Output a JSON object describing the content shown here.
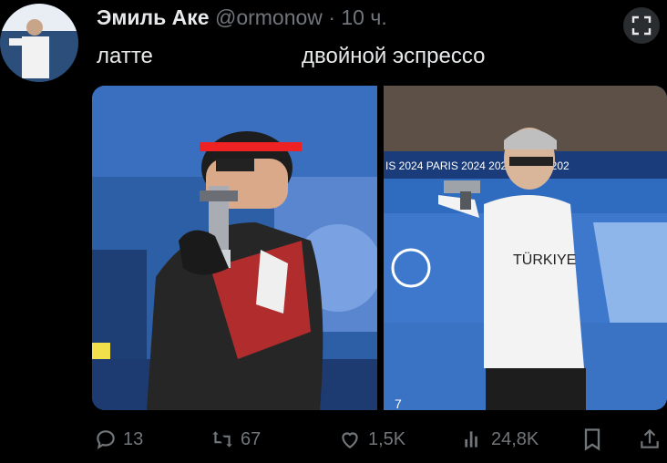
{
  "tweet": {
    "author_name": "Эмиль Аке",
    "handle": "@ormonow",
    "separator": "·",
    "time": "10 ч.",
    "caption_left": "латте",
    "caption_right": "двойной эспрессо"
  },
  "images": {
    "left_banner_text": "",
    "right_banner_text": "IS 2024   PARIS 2024   2024   PARIS 202",
    "right_shirt_text": "TÜRKIYE",
    "right_bottom_number": "7"
  },
  "actions": {
    "replies": "13",
    "retweets": "67",
    "likes": "1,5K",
    "views": "24,8K"
  },
  "icons": {
    "reply": "reply-icon",
    "retweet": "retweet-icon",
    "like": "heart-icon",
    "views": "bar-chart-icon",
    "bookmark": "bookmark-icon",
    "share": "share-icon",
    "expand": "expand-icon"
  },
  "colors": {
    "background": "#000000",
    "muted": "#71767b",
    "text": "#e7e9ea"
  }
}
